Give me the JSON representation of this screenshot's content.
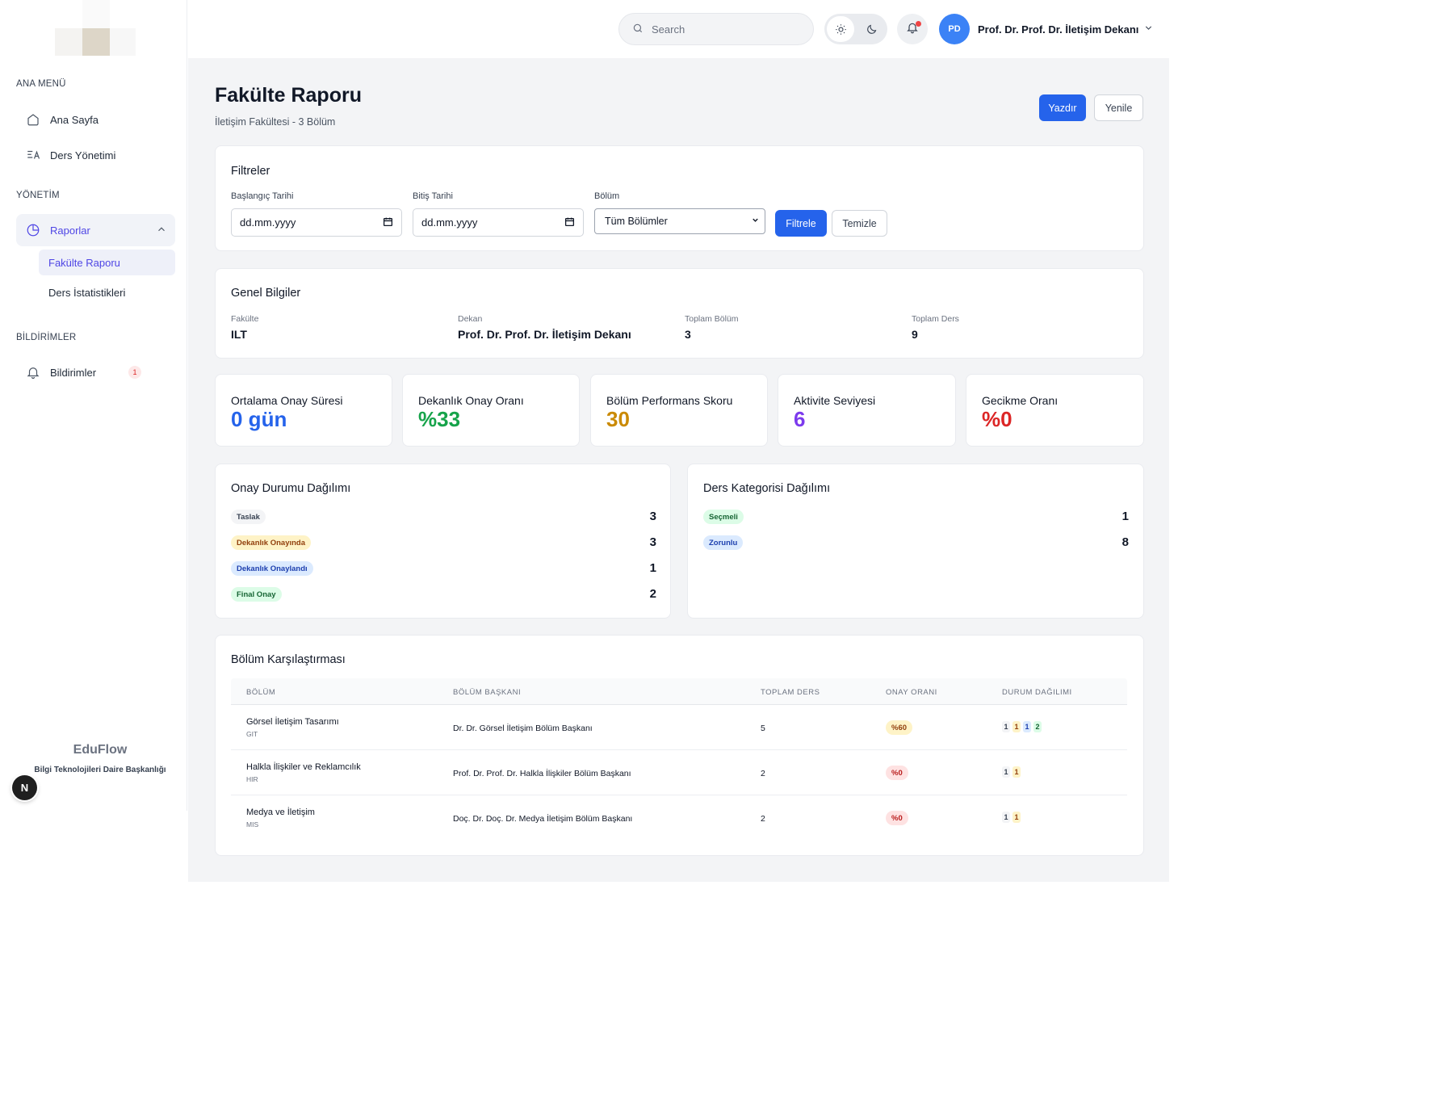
{
  "topbar": {
    "search_placeholder": "Search",
    "avatar_initials": "PD",
    "user_name": "Prof. Dr. Prof. Dr. İletişim Dekanı"
  },
  "sidebar": {
    "sections": {
      "main": "ANA MENÜ",
      "admin": "YÖNETİM",
      "notifications": "BİLDİRİMLER"
    },
    "items": {
      "home": "Ana Sayfa",
      "courses": "Ders Yönetimi",
      "reports": "Raporlar",
      "faculty_report": "Fakülte Raporu",
      "course_stats": "Ders İstatistikleri",
      "notifications": "Bildirimler",
      "notifications_count": "1"
    },
    "brand_name": "EduFlow",
    "brand_sub": "Bilgi Teknolojileri Daire Başkanlığı",
    "n_badge": "N"
  },
  "header": {
    "title": "Fakülte Raporu",
    "subtitle": "İletişim Fakültesi - 3 Bölüm",
    "print_label": "Yazdır",
    "refresh_label": "Yenile"
  },
  "filters": {
    "title": "Filtreler",
    "start_label": "Başlangıç Tarihi",
    "end_label": "Bitiş Tarihi",
    "dept_label": "Bölüm",
    "date_placeholder": "dd.mm.yyyy",
    "dept_value": "Tüm Bölümler",
    "filter_button": "Filtrele",
    "clear_button": "Temizle"
  },
  "general": {
    "title": "Genel Bilgiler",
    "faculty_label": "Fakülte",
    "faculty_value": "ILT",
    "dean_label": "Dekan",
    "dean_value": "Prof. Dr. Prof. Dr. İletişim Dekanı",
    "dept_count_label": "Toplam Bölüm",
    "dept_count_value": "3",
    "course_count_label": "Toplam Ders",
    "course_count_value": "9"
  },
  "stats": [
    {
      "label": "Ortalama Onay Süresi",
      "value": "0 gün",
      "color": "#2563eb"
    },
    {
      "label": "Dekanlık Onay Oranı",
      "value": "%33",
      "color": "#16a34a"
    },
    {
      "label": "Bölüm Performans Skoru",
      "value": "30",
      "color": "#ca8a04"
    },
    {
      "label": "Aktivite Seviyesi",
      "value": "6",
      "color": "#7c3aed"
    },
    {
      "label": "Gecikme Oranı",
      "value": "%0",
      "color": "#dc2626"
    }
  ],
  "approval": {
    "title": "Onay Durumu Dağılımı",
    "items": [
      {
        "label": "Taslak",
        "count": "3"
      },
      {
        "label": "Dekanlık Onayında",
        "count": "3"
      },
      {
        "label": "Dekanlık Onaylandı",
        "count": "1"
      },
      {
        "label": "Final Onay",
        "count": "2"
      }
    ]
  },
  "category": {
    "title": "Ders Kategorisi Dağılımı",
    "items": [
      {
        "label": "Seçmeli",
        "count": "1"
      },
      {
        "label": "Zorunlu",
        "count": "8"
      }
    ]
  },
  "comparison": {
    "title": "Bölüm Karşılaştırması",
    "headers": [
      "BÖLÜM",
      "BÖLÜM BAŞKANI",
      "TOPLAM DERS",
      "ONAY ORANI",
      "DURUM DAĞILIMI"
    ],
    "rows": [
      {
        "name": "Görsel İletişim Tasarımı",
        "code": "GIT",
        "head": "Dr. Dr. Görsel İletişim Bölüm Başkanı",
        "total": "5",
        "rate": "%60",
        "chips": [
          "1",
          "1",
          "1",
          "2"
        ]
      },
      {
        "name": "Halkla İlişkiler ve Reklamcılık",
        "code": "HIR",
        "head": "Prof. Dr. Prof. Dr. Halkla İlişkiler Bölüm Başkanı",
        "total": "2",
        "rate": "%0",
        "chips": [
          "1",
          "1"
        ]
      },
      {
        "name": "Medya ve İletişim",
        "code": "MIS",
        "head": "Doç. Dr. Doç. Dr. Medya İletişim Bölüm Başkanı",
        "total": "2",
        "rate": "%0",
        "chips": [
          "1",
          "1"
        ]
      }
    ]
  },
  "colors": {
    "primary": "#2563eb",
    "active_nav": "#4f46e5",
    "rate_warn": "#fef3c7",
    "rate_bad": "#fee2e2"
  }
}
